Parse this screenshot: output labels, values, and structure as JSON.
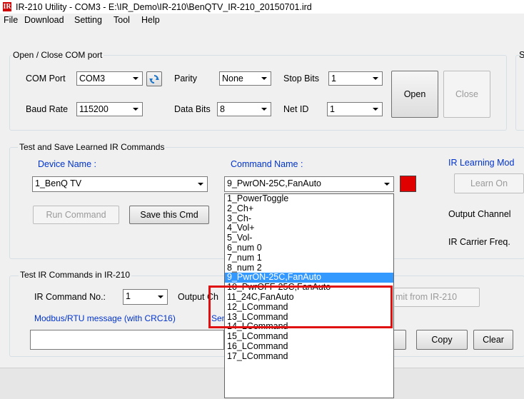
{
  "window": {
    "title": "IR-210 Utility - COM3 - E:\\IR_Demo\\IR-210\\BenQTV_IR-210_20150701.ird",
    "icon_text": "IR"
  },
  "menu": [
    "File",
    "Download",
    "Setting",
    "Tool",
    "Help"
  ],
  "com_group": {
    "title": "Open / Close COM port",
    "com_port_label": "COM Port",
    "com_port_value": "COM3",
    "parity_label": "Parity",
    "parity_value": "None",
    "stop_bits_label": "Stop Bits",
    "stop_bits_value": "1",
    "baud_label": "Baud Rate",
    "baud_value": "115200",
    "data_bits_label": "Data Bits",
    "data_bits_value": "8",
    "net_id_label": "Net ID",
    "net_id_value": "1",
    "open_label": "Open",
    "close_label": "Close",
    "right_group_partial": "S"
  },
  "learned_group": {
    "title": "Test and Save Learned IR Commands",
    "device_label": "Device Name :",
    "device_value": "1_BenQ TV",
    "command_label": "Command Name :",
    "command_value": "9_PwrON-25C,FanAuto",
    "learn_mode_label": "IR Learning Mod",
    "learn_on_label": "Learn On",
    "run_label": "Run Command",
    "save_label": "Save this Cmd",
    "output_channel_label": "Output Channel",
    "carrier_label": "IR Carrier Freq.",
    "status_color": "#e00000"
  },
  "test_group": {
    "title": "Test IR Commands in IR-210",
    "cmd_no_label": "IR Command No.:",
    "cmd_no_value": "1",
    "output_partial": "Output Ch",
    "emit_partial": "mit from IR-210",
    "modbus_label": "Modbus/RTU message (with CRC16)",
    "modbus_partial": "Sen",
    "copy_label": "Copy",
    "clear_label": "Clear"
  },
  "dropdown_items": [
    "1_PowerToggle",
    "2_Ch+",
    "3_Ch-",
    "4_Vol+",
    "5_Vol-",
    "6_num 0",
    "7_num 1",
    "8_num 2",
    "9_PwrON-25C,FanAuto",
    "10_PwrOFF-25C,FanAuto",
    "11_24C,FanAuto",
    "12_LCommand",
    "13_LCommand",
    "14_LCommand",
    "15_LCommand",
    "16_LCommand",
    "17_LCommand"
  ],
  "selected_index": 8
}
